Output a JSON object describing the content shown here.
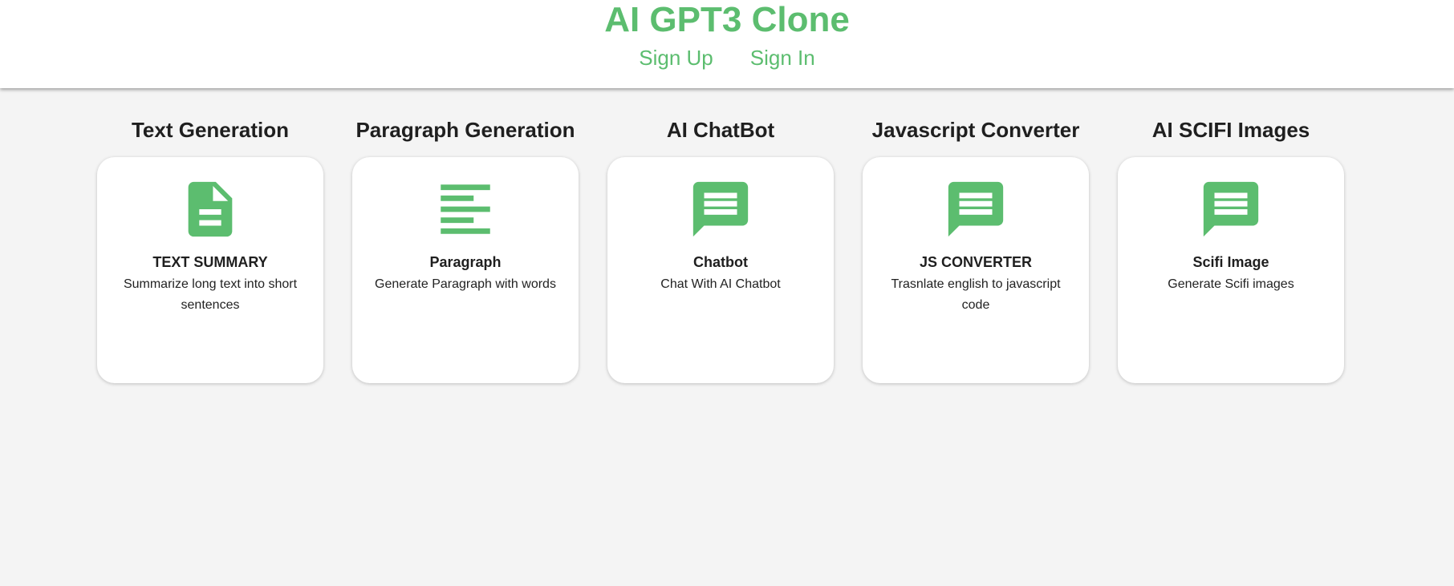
{
  "header": {
    "brand": "AI GPT3 Clone",
    "nav": [
      {
        "label": "Sign Up"
      },
      {
        "label": "Sign In"
      }
    ]
  },
  "accent_color": "#5cbd6f",
  "cards": [
    {
      "section_title": "Text Generation",
      "icon": "document-icon",
      "title": "TEXT SUMMARY",
      "description": "Summarize long text into short sentences"
    },
    {
      "section_title": "Paragraph Generation",
      "icon": "paragraph-lines-icon",
      "title": "Paragraph",
      "description": "Generate Paragraph with words"
    },
    {
      "section_title": "AI ChatBot",
      "icon": "chat-bubble-icon",
      "title": "Chatbot",
      "description": "Chat With AI Chatbot"
    },
    {
      "section_title": "Javascript Converter",
      "icon": "chat-bubble-icon",
      "title": "JS CONVERTER",
      "description": "Trasnlate english to javascript code"
    },
    {
      "section_title": "AI SCIFI Images",
      "icon": "chat-bubble-icon",
      "title": "Scifi Image",
      "description": "Generate Scifi images"
    }
  ]
}
